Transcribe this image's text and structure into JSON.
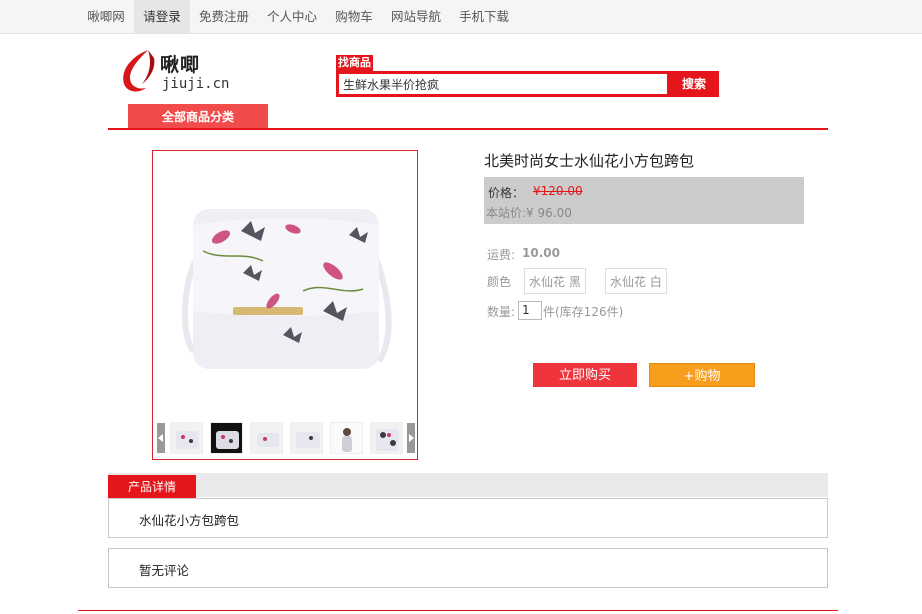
{
  "topnav": {
    "items": [
      "啾唧网",
      "请登录",
      "免费注册",
      "个人中心",
      "购物车",
      "网站导航",
      "手机下载"
    ],
    "active_index": 1
  },
  "logo": {
    "cn": "啾唧",
    "en": "jiuji.cn"
  },
  "search": {
    "tag": "找商品",
    "value": "生鲜水果半价抢疯",
    "button": "搜索"
  },
  "category": {
    "label": "全部商品分类"
  },
  "product": {
    "title": "北美时尚女士水仙花小方包跨包",
    "price_label": "价格：",
    "old_price": "¥120.00",
    "site_price": "本站价:¥ 96.00",
    "shipping_label": "运费:",
    "shipping_value": "10.00",
    "color_label": "颜色",
    "colors": [
      "水仙花 黑",
      "水仙花 白"
    ],
    "qty_label": "数量:",
    "qty_value": "1",
    "stock_text": "件(库存126件)",
    "buy_label": "立即购买",
    "cart_label": "+购物"
  },
  "details": {
    "tab_label": "产品详情",
    "content": "水仙花小方包跨包",
    "reviews": "暂无评论"
  },
  "colors": {
    "accent": "#e4151b",
    "orange": "#f89d1c"
  }
}
